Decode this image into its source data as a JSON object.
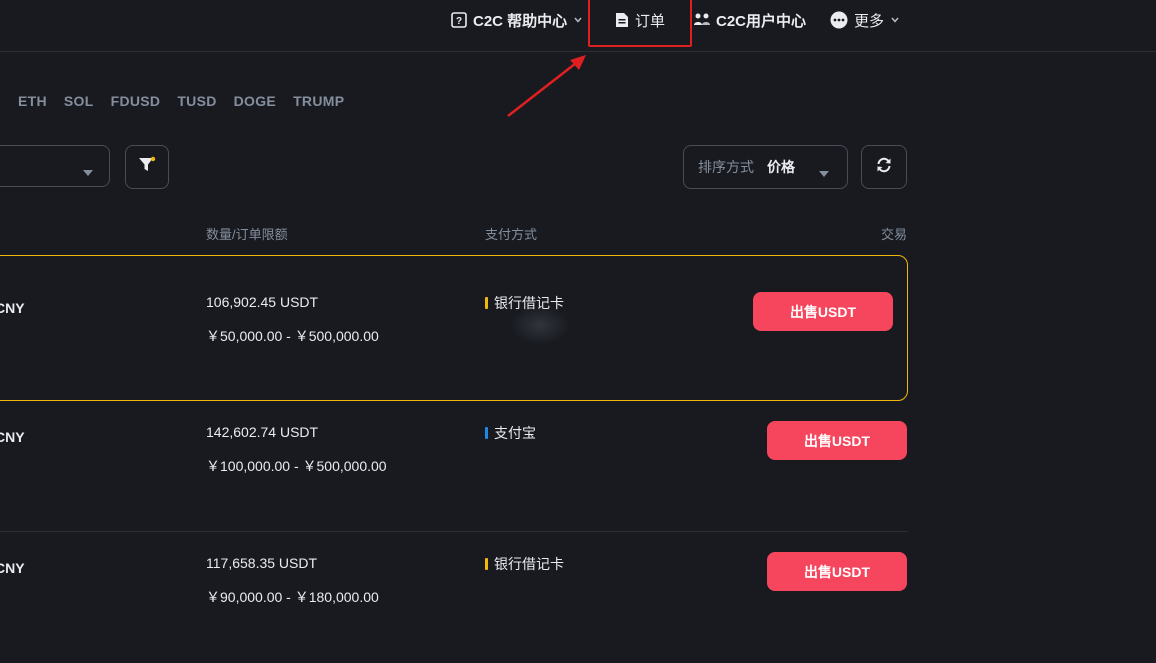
{
  "nav": {
    "help": "C2C 帮助中心",
    "orders": "订单",
    "user_center": "C2C用户中心",
    "more": "更多"
  },
  "tabs": [
    "ETH",
    "SOL",
    "FDUSD",
    "TUSD",
    "DOGE",
    "TRUMP"
  ],
  "toolbar": {
    "sort_label": "排序方式",
    "sort_value": "价格"
  },
  "columns": {
    "amount_limits": "数量/订单限额",
    "payment": "支付方式",
    "trade": "交易"
  },
  "rows": [
    {
      "fiat": "CNY",
      "quantity": "106,902.45 USDT",
      "limits": "￥50,000.00 - ￥500,000.00",
      "payment": "银行借记卡",
      "payment_color": "#f0b90b",
      "action": "出售USDT"
    },
    {
      "fiat": "CNY",
      "quantity": "142,602.74 USDT",
      "limits": "￥100,000.00 - ￥500,000.00",
      "payment": "支付宝",
      "payment_color": "#1e88e5",
      "action": "出售USDT"
    },
    {
      "fiat": "CNY",
      "quantity": "117,658.35 USDT",
      "limits": "￥90,000.00 - ￥180,000.00",
      "payment": "银行借记卡",
      "payment_color": "#f0b90b",
      "action": "出售USDT"
    }
  ],
  "colors": {
    "background": "#181a20",
    "sell": "#f6465d",
    "featured_border": "#f0b90b",
    "annotation": "#e02020"
  }
}
